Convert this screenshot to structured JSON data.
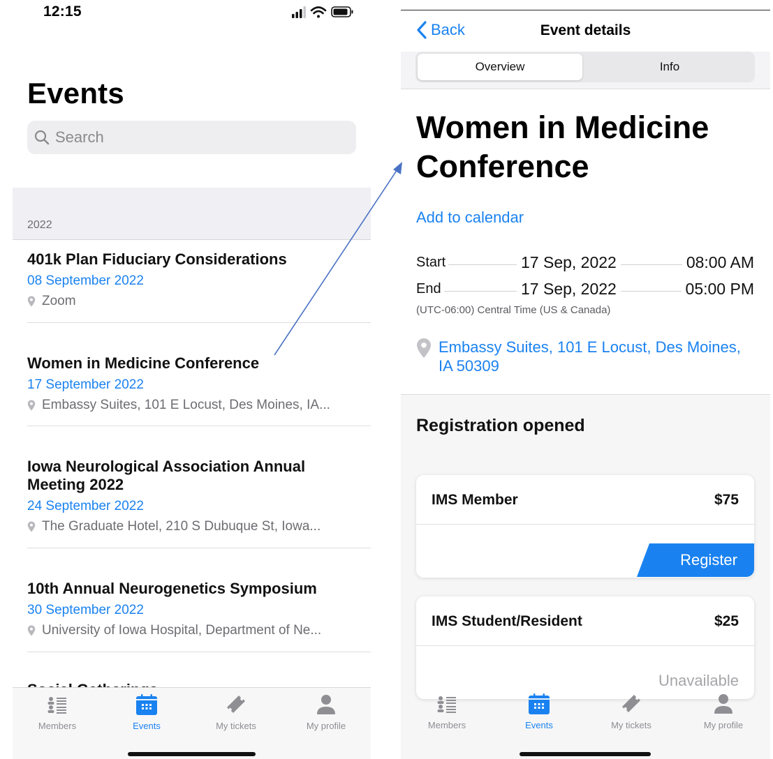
{
  "left": {
    "status_time": "12:15",
    "title": "Events",
    "search_placeholder": "Search",
    "section_year": "2022",
    "events": [
      {
        "title": "401k Plan Fiduciary Considerations",
        "date": "08 September 2022",
        "location": "Zoom"
      },
      {
        "title": "Women in Medicine Conference",
        "date": "17 September 2022",
        "location": "Embassy Suites, 101 E Locust, Des Moines, IA..."
      },
      {
        "title": "Iowa Neurological Association Annual Meeting 2022",
        "date": "24 September 2022",
        "location": "The Graduate Hotel, 210 S Dubuque St, Iowa..."
      },
      {
        "title": "10th Annual Neurogenetics Symposium",
        "date": "30 September 2022",
        "location": "University of Iowa Hospital, Department of Ne..."
      }
    ],
    "peek_title": "Social Gatherings"
  },
  "tabs": [
    {
      "label": "Members",
      "icon": "members-icon"
    },
    {
      "label": "Events",
      "icon": "calendar-icon",
      "active": true
    },
    {
      "label": "My tickets",
      "icon": "ticket-icon"
    },
    {
      "label": "My profile",
      "icon": "person-icon"
    }
  ],
  "right": {
    "back_label": "Back",
    "nav_title": "Event details",
    "segments": [
      "Overview",
      "Info"
    ],
    "selected_segment": "Overview",
    "event_title": "Women in Medicine Conference",
    "add_to_calendar": "Add to calendar",
    "start_label": "Start",
    "start_date": "17 Sep, 2022",
    "start_time": "08:00 AM",
    "end_label": "End",
    "end_date": "17 Sep, 2022",
    "end_time": "05:00 PM",
    "timezone": "(UTC-06:00) Central Time (US & Canada)",
    "venue": "Embassy Suites, 101 E Locust, Des Moines, IA 50309",
    "registration_heading": "Registration opened",
    "tickets": [
      {
        "name": "IMS Member",
        "price": "$75",
        "action": "Register",
        "available": true
      },
      {
        "name": "IMS Student/Resident",
        "price": "$25",
        "action": "Unavailable",
        "available": false
      }
    ]
  },
  "colors": {
    "accent": "#1a82f0",
    "secondary_text": "#6d6d72",
    "section_bg": "#efeff4",
    "arrow": "#4a72c4"
  }
}
